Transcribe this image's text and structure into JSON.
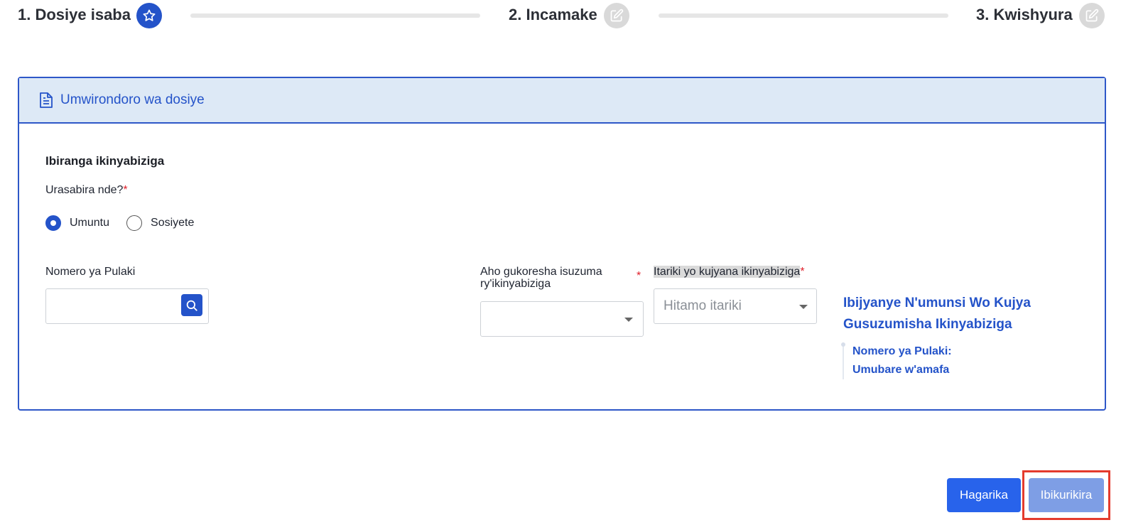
{
  "stepper": {
    "steps": [
      {
        "label": "1. Dosiye isaba",
        "icon": "star-icon",
        "state": "active"
      },
      {
        "label": "2. Incamake",
        "icon": "edit-icon",
        "state": "inactive"
      },
      {
        "label": "3. Kwishyura",
        "icon": "edit-icon",
        "state": "inactive"
      }
    ]
  },
  "card": {
    "title": "Umwirondoro wa dosiye",
    "section_title": "Ibiranga ikinyabiziga",
    "applicant_question": "Urasabira nde?",
    "required_mark": "*",
    "radio_options": [
      {
        "label": "Umuntu",
        "checked": true
      },
      {
        "label": "Sosiyete",
        "checked": false
      }
    ],
    "plate_label": "Nomero ya Pulaki",
    "plate_value": "",
    "inspection_location_label": "Aho gukoresha isuzuma ry'ikinyabiziga",
    "inspection_location_value": "",
    "date_label": "Itariki yo kujyana ikinyabiziga",
    "date_placeholder": "Hitamo itariki",
    "info_title": "Ibijyanye N'umunsi Wo Kujya Gusuzumisha Ikinyabiziga",
    "info_plate": "Nomero ya Pulaki:",
    "info_safety": "Umubare w'amafa"
  },
  "actions": {
    "cancel_label": "Hagarika",
    "next_label": "Ibikurikira"
  },
  "colors": {
    "primary": "#2453c9",
    "header_bg": "#dde9f6",
    "cancel_button": "#2863eb",
    "next_button_disabled": "#7e9ee5",
    "required": "#e0222d",
    "focus_frame": "#e43b2d"
  }
}
